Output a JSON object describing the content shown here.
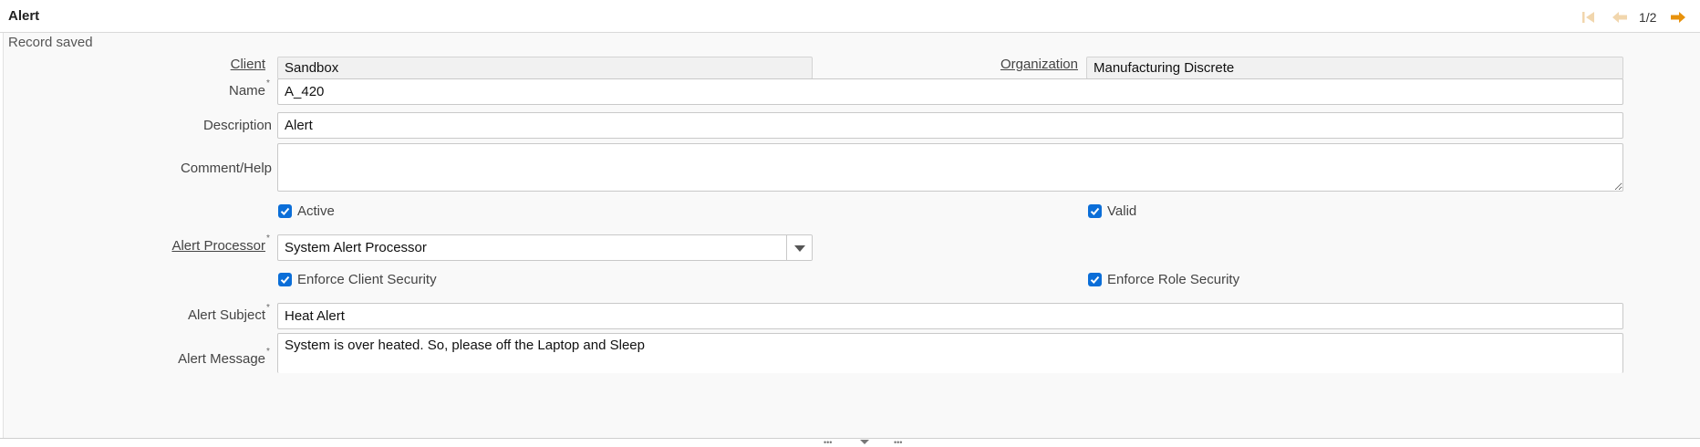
{
  "window": {
    "title": "Alert"
  },
  "nav": {
    "counter": "1/2"
  },
  "status": {
    "message": "Record saved"
  },
  "form": {
    "client": {
      "label": "Client",
      "value": "Sandbox"
    },
    "organization": {
      "label": "Organization",
      "value": "Manufacturing Discrete"
    },
    "name": {
      "label": "Name",
      "value": "A_420",
      "required": "*"
    },
    "description": {
      "label": "Description",
      "value": "Alert"
    },
    "comment_help": {
      "label": "Comment/Help",
      "value": ""
    },
    "active": {
      "label": "Active",
      "checked": true
    },
    "valid": {
      "label": "Valid",
      "checked": true
    },
    "alert_processor": {
      "label": "Alert Processor",
      "value": "System Alert Processor",
      "required": "*"
    },
    "enforce_client_security": {
      "label": "Enforce Client Security",
      "checked": true
    },
    "enforce_role_security": {
      "label": "Enforce Role Security",
      "checked": true
    },
    "alert_subject": {
      "label": "Alert Subject",
      "value": "Heat Alert",
      "required": "*"
    },
    "alert_message": {
      "label": "Alert Message",
      "value": "System is over heated. So, please off the Laptop and Sleep",
      "required": "*"
    }
  },
  "icons": {
    "first": "skip-first-icon",
    "prev": "arrow-left-icon",
    "next": "arrow-right-icon",
    "dropdown": "chevron-down-icon",
    "check": "checkmark-icon"
  },
  "colors": {
    "accent": "#0b6ed8",
    "nav_active": "#e8920c",
    "nav_disabled": "#f1d6ad",
    "content_bg": "#f9f9f9",
    "readonly_bg": "#f1f1f1"
  }
}
